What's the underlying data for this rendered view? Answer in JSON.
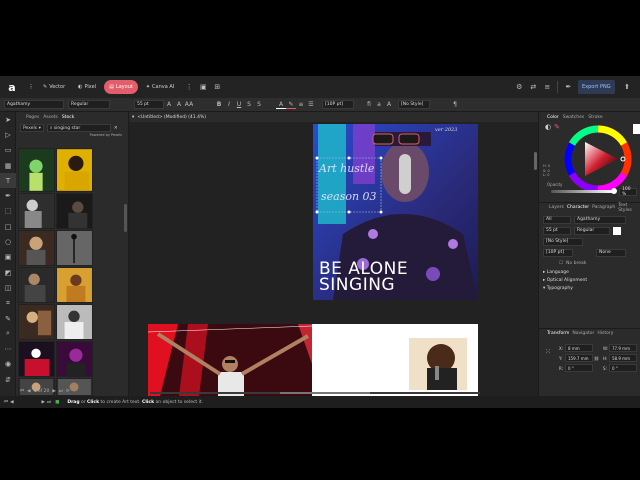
{
  "app": {
    "logo": "a",
    "personas": [
      {
        "label": "Vector",
        "icon": "✎"
      },
      {
        "label": "Pixel",
        "icon": "◐"
      },
      {
        "label": "Layout",
        "icon": "▤"
      },
      {
        "label": "Canva AI",
        "icon": "✦"
      }
    ],
    "export_label": "Export PNG"
  },
  "context_toolbar": {
    "font_family": "Agathamy",
    "font_style": "Regular",
    "font_size": "55 pt",
    "size_unit": "AA",
    "bold": "B",
    "italic": "I",
    "underline": "U",
    "tracking": "[10P pt]",
    "style": "[No Style]"
  },
  "left_panel": {
    "tabs": [
      "Pages",
      "Assets",
      "Stock"
    ],
    "active_tab": "Stock",
    "source": "Pexels",
    "search_value": "singing star",
    "powered_by": "Powered by Pexels",
    "pagination": "1 of 20"
  },
  "document": {
    "title": "<Untitled> (Modified) (41.4%)"
  },
  "page1": {
    "handwritten_line1": "Art hustle",
    "handwritten_line2": "season 03",
    "corner_text": "ver 2023",
    "headline_line1": "BE ALONE",
    "headline_line2": "SINGING"
  },
  "right_panel": {
    "top_tabs": [
      "Color",
      "Swatches",
      "Stroke"
    ],
    "hsl_labels": [
      "H: 0",
      "S: 0",
      "L: 0"
    ],
    "opacity_label": "Opacity",
    "opacity_value": "100 %",
    "char_tabs": [
      "Layers",
      "Character",
      "Paragraph",
      "Text Styles"
    ],
    "char_all": "All",
    "char_font": "Agathamy",
    "char_size": "55 pt",
    "char_style": "Regular",
    "char_nostyle": "[No Style]",
    "char_tracking": "[10P pt]",
    "char_none": "None",
    "no_break": "No break",
    "sections": [
      "Language",
      "Optical Alignment",
      "Typography"
    ],
    "transform_tabs": [
      "Transform",
      "Navigator",
      "History"
    ],
    "x_label": "X:",
    "x_value": "8 mm",
    "y_label": "Y:",
    "y_value": "159.7 mm",
    "r_label": "R:",
    "r_value": "0 °",
    "w_label": "W:",
    "w_value": "77.9 mm",
    "h_label": "H:",
    "h_value": "58.9 mm",
    "s_label": "S:",
    "s_value": "0 °"
  },
  "status_bar": {
    "drag": "Drag",
    "text1": " or ",
    "click": "Click",
    "text2": " to create Art text. ",
    "click2": "Click",
    "text3": " an object to select it."
  },
  "colors": {
    "accent": "#e35d6a",
    "app_bg": "#2b2b2b",
    "canvas_bg": "#222222",
    "poster_purple": "#27276a"
  }
}
